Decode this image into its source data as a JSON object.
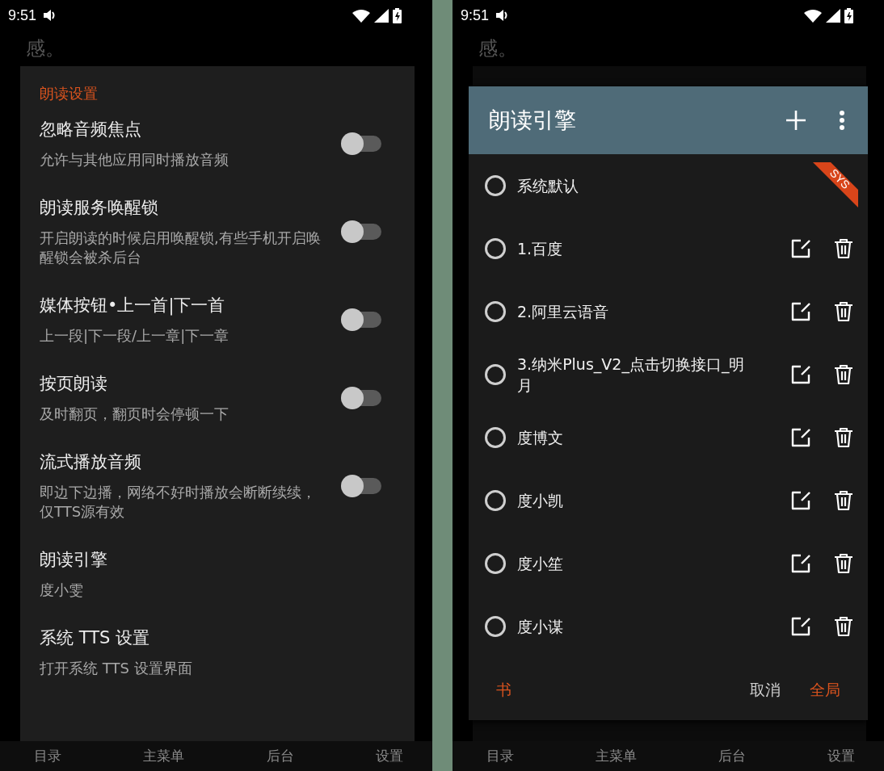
{
  "screens": [
    {
      "status_bar": {
        "time": "9:51"
      },
      "background_text": "感。",
      "settings": {
        "section_title": "朗读设置",
        "items": [
          {
            "kind": "switch",
            "title": "忽略音频焦点",
            "subtitle": "允许与其他应用同时播放音频",
            "on": false
          },
          {
            "kind": "switch",
            "title": "朗读服务唤醒锁",
            "subtitle": "开启朗读的时候启用唤醒锁,有些手机开启唤醒锁会被杀后台",
            "on": false
          },
          {
            "kind": "switch",
            "title": "媒体按钮•上一首|下一首",
            "subtitle": "上一段|下一段/上一章|下一章",
            "on": false
          },
          {
            "kind": "switch",
            "title": "按页朗读",
            "subtitle": "及时翻页，翻页时会停顿一下",
            "on": false
          },
          {
            "kind": "switch",
            "title": "流式播放音频",
            "subtitle": "即边下边播，网络不好时播放会断断续续，仅TTS源有效",
            "on": false
          },
          {
            "kind": "text",
            "title": "朗读引擎",
            "subtitle": "度小雯"
          },
          {
            "kind": "text",
            "title": "系统 TTS 设置",
            "subtitle": "打开系统 TTS 设置界面"
          }
        ]
      },
      "bottom_nav": [
        "目录",
        "主菜单",
        "后台",
        "设置"
      ]
    },
    {
      "status_bar": {
        "time": "9:51"
      },
      "background_text": "感。",
      "dialog": {
        "title": "朗读引擎",
        "badge": "SYS",
        "engines": [
          {
            "name": "系统默认",
            "selected": false,
            "system": true
          },
          {
            "name": "1.百度",
            "selected": false,
            "system": false
          },
          {
            "name": "2.阿里云语音",
            "selected": false,
            "system": false
          },
          {
            "name": "3.纳米Plus_V2_点击切换接口_明月",
            "selected": false,
            "system": false
          },
          {
            "name": "度博文",
            "selected": false,
            "system": false
          },
          {
            "name": "度小凯",
            "selected": false,
            "system": false
          },
          {
            "name": "度小笙",
            "selected": false,
            "system": false
          },
          {
            "name": "度小谋",
            "selected": false,
            "system": false
          }
        ],
        "buttons": [
          {
            "label": "书",
            "kind": "accent"
          },
          {
            "label": "取消",
            "kind": "plain"
          },
          {
            "label": "全局",
            "kind": "accent"
          }
        ]
      },
      "bottom_nav": [
        "目录",
        "主菜单",
        "后台",
        "设置"
      ]
    }
  ]
}
